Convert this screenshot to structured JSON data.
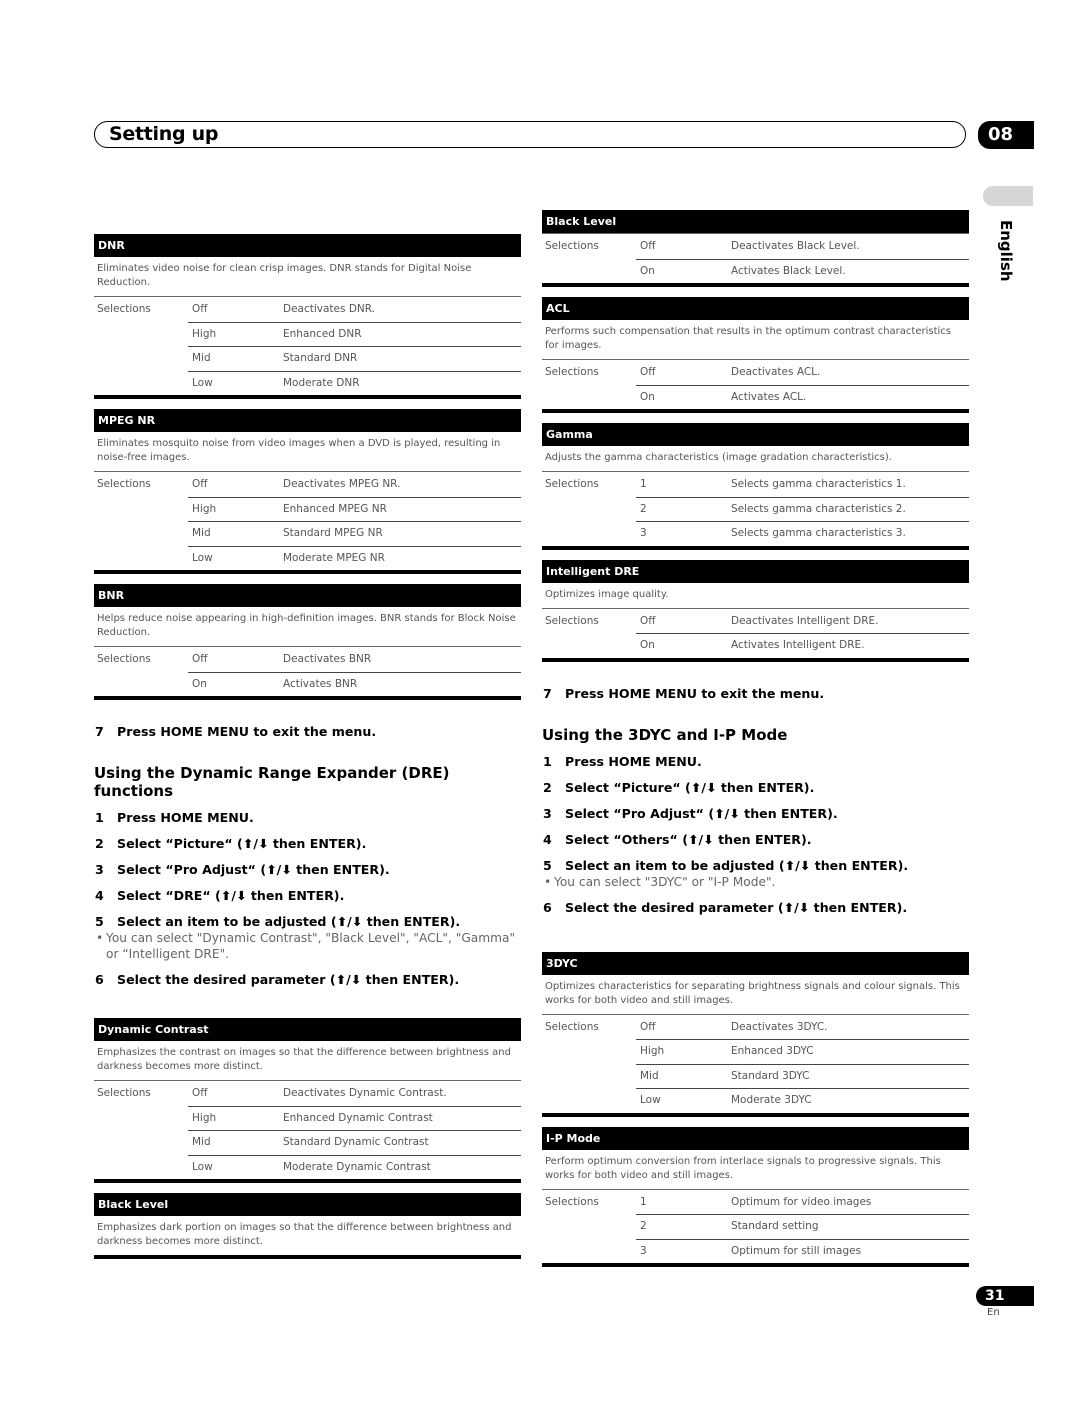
{
  "header": {
    "title": "Setting up",
    "chapter": "08"
  },
  "language_tab": "English",
  "page": {
    "number": "31",
    "lang": "En"
  },
  "arrow_glyph": "⬆/⬇",
  "left": {
    "dnr": {
      "title": "DNR",
      "description": "Eliminates video noise for clean crisp images. DNR stands for Digital Noise Reduction.",
      "label": "Selections",
      "rows": [
        {
          "value": "Off",
          "meaning": "Deactivates DNR."
        },
        {
          "value": "High",
          "meaning": "Enhanced DNR"
        },
        {
          "value": "Mid",
          "meaning": "Standard DNR"
        },
        {
          "value": "Low",
          "meaning": "Moderate DNR"
        }
      ]
    },
    "mpeg_nr": {
      "title": "MPEG NR",
      "description": "Eliminates mosquito noise from video images when a DVD is played, resulting in noise-free images.",
      "label": "Selections",
      "rows": [
        {
          "value": "Off",
          "meaning": "Deactivates MPEG NR."
        },
        {
          "value": "High",
          "meaning": "Enhanced MPEG NR"
        },
        {
          "value": "Mid",
          "meaning": "Standard MPEG NR"
        },
        {
          "value": "Low",
          "meaning": "Moderate MPEG NR"
        }
      ]
    },
    "bnr": {
      "title": "BNR",
      "description": "Helps reduce noise appearing in high-definition images. BNR stands for Block Noise Reduction.",
      "label": "Selections",
      "rows": [
        {
          "value": "Off",
          "meaning": "Deactivates BNR"
        },
        {
          "value": "On",
          "meaning": "Activates BNR"
        }
      ]
    },
    "step7": {
      "n": "7",
      "text": "Press HOME MENU to exit the menu."
    },
    "dre_heading": "Using the Dynamic Range Expander (DRE) functions",
    "dre_steps": [
      {
        "n": "1",
        "text": "Press HOME MENU."
      },
      {
        "n": "2",
        "pre": "Select “Picture“ (",
        "post": " then ENTER)."
      },
      {
        "n": "3",
        "pre": "Select “Pro Adjust“ (",
        "post": " then ENTER)."
      },
      {
        "n": "4",
        "pre": "Select “DRE“ (",
        "post": " then ENTER)."
      },
      {
        "n": "5",
        "pre": "Select an item to be adjusted (",
        "post": " then ENTER)."
      },
      {
        "n": "6",
        "pre": "Select the desired parameter (",
        "post": " then ENTER)."
      }
    ],
    "dre_note": "You can select \"Dynamic Contrast\", \"Black Level\", \"ACL\",  \"Gamma\" or “Intelligent DRE\".",
    "dynamic_contrast": {
      "title": "Dynamic Contrast",
      "description": "Emphasizes the contrast on images so that the difference between brightness and darkness becomes more distinct.",
      "label": "Selections",
      "rows": [
        {
          "value": "Off",
          "meaning": "Deactivates Dynamic Contrast."
        },
        {
          "value": "High",
          "meaning": "Enhanced Dynamic Contrast"
        },
        {
          "value": "Mid",
          "meaning": "Standard Dynamic Contrast"
        },
        {
          "value": "Low",
          "meaning": "Moderate Dynamic Contrast"
        }
      ]
    },
    "black_level": {
      "title": "Black Level",
      "description": "Emphasizes dark portion on images so that the difference between brightness and darkness becomes more distinct."
    }
  },
  "right": {
    "black_level": {
      "title": "Black Level",
      "label": "Selections",
      "rows": [
        {
          "value": "Off",
          "meaning": "Deactivates Black Level."
        },
        {
          "value": "On",
          "meaning": "Activates Black Level."
        }
      ]
    },
    "acl": {
      "title": "ACL",
      "description": "Performs such compensation that results in the optimum contrast characteristics for images.",
      "label": "Selections",
      "rows": [
        {
          "value": "Off",
          "meaning": "Deactivates ACL."
        },
        {
          "value": "On",
          "meaning": "Activates ACL."
        }
      ]
    },
    "gamma": {
      "title": "Gamma",
      "description": "Adjusts the gamma characteristics (image gradation characteristics).",
      "label": "Selections",
      "rows": [
        {
          "value": "1",
          "meaning": "Selects gamma characteristics 1."
        },
        {
          "value": "2",
          "meaning": "Selects gamma characteristics 2."
        },
        {
          "value": "3",
          "meaning": "Selects gamma characteristics 3."
        }
      ]
    },
    "intelligent_dre": {
      "title": "Intelligent DRE",
      "description": "Optimizes image quality.",
      "label": "Selections",
      "rows": [
        {
          "value": "Off",
          "meaning": "Deactivates Intelligent DRE."
        },
        {
          "value": "On",
          "meaning": "Activates Intelligent DRE."
        }
      ]
    },
    "step7": {
      "n": "7",
      "text": "Press HOME MENU to exit the menu."
    },
    "ydc_heading": "Using the 3DYC and I-P Mode",
    "ydc_steps": [
      {
        "n": "1",
        "text": "Press HOME MENU."
      },
      {
        "n": "2",
        "pre": "Select “Picture“ (",
        "post": " then ENTER)."
      },
      {
        "n": "3",
        "pre": "Select “Pro Adjust“ (",
        "post": " then ENTER)."
      },
      {
        "n": "4",
        "pre": "Select “Others“ (",
        "post": " then ENTER)."
      },
      {
        "n": "5",
        "pre": "Select an item to be adjusted (",
        "post": " then ENTER)."
      },
      {
        "n": "6",
        "pre": "Select the desired parameter (",
        "post": " then ENTER)."
      }
    ],
    "ydc_note": "You can select \"3DYC\" or \"I-P Mode\".",
    "ydc": {
      "title": "3DYC",
      "description": "Optimizes characteristics for separating brightness signals and colour signals. This works for both video and still images.",
      "label": "Selections",
      "rows": [
        {
          "value": "Off",
          "meaning": "Deactivates 3DYC."
        },
        {
          "value": "High",
          "meaning": "Enhanced 3DYC"
        },
        {
          "value": "Mid",
          "meaning": "Standard 3DYC"
        },
        {
          "value": "Low",
          "meaning": "Moderate 3DYC"
        }
      ]
    },
    "ip_mode": {
      "title": "I-P Mode",
      "description": "Perform optimum conversion from interlace signals to progressive signals. This works for both video and still images.",
      "label": "Selections",
      "rows": [
        {
          "value": "1",
          "meaning": "Optimum for video images"
        },
        {
          "value": "2",
          "meaning": "Standard setting"
        },
        {
          "value": "3",
          "meaning": "Optimum for still images"
        }
      ]
    }
  }
}
